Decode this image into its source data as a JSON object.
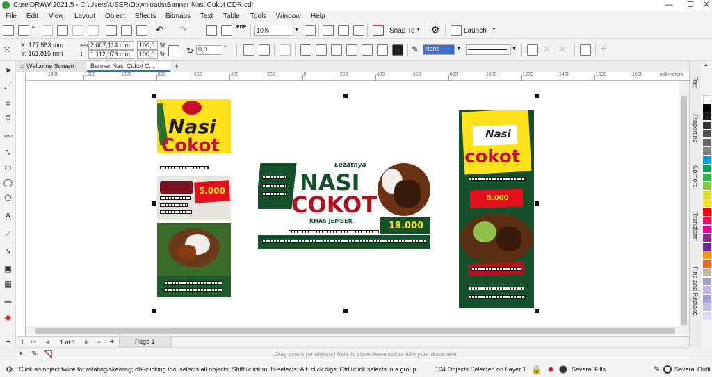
{
  "window": {
    "title": "CorelDRAW 2021.5 - C:\\Users\\USER\\Downloads\\Banner Nasi Cokot CDR.cdr",
    "minimize": "—",
    "maximize": "☐",
    "close": "✕"
  },
  "menu": [
    "File",
    "Edit",
    "View",
    "Layout",
    "Object",
    "Effects",
    "Bitmaps",
    "Text",
    "Table",
    "Tools",
    "Window",
    "Help"
  ],
  "standard_toolbar": {
    "zoom": "10%",
    "snap_to": "Snap To",
    "launch": "Launch"
  },
  "property_bar": {
    "x": "X: 177,553 mm",
    "y": "Y: 161,816 mm",
    "width": "2.007,114 mm",
    "height": "1.112,073 mm",
    "scale_w": "100,0",
    "scale_h": "100,0",
    "percent": "%",
    "angle": "0,0",
    "angle_unit": "°",
    "outline_fill": "None"
  },
  "tabs": [
    "Welcome Screen",
    "Banner Nasi Cokot C..."
  ],
  "ruler": {
    "labels": [
      "1400",
      "1200",
      "1000",
      "800",
      "600",
      "400",
      "200",
      "0",
      "200",
      "400",
      "600",
      "800",
      "1000",
      "1200",
      "1400",
      "1600",
      "1800"
    ],
    "unit": "millimeters"
  },
  "dockers": [
    "Text",
    "Properties",
    "Corners",
    "Transform",
    "Find and Replace"
  ],
  "page_nav": {
    "count": "1 of 1",
    "page_tab": "Page 1"
  },
  "color_tray_hint": "Drag colors (or objects) here to store these colors with your document",
  "status": {
    "hint": "Click an object twice for rotating/skewing; dbl-clicking tool selects all objects; Shift+click multi-selects; Alt+click digs; Ctrl+click selects in a group",
    "selection": "104 Objects Selected on Layer 1",
    "fill": "Several Fills",
    "outline": "Several Outli"
  },
  "palette_colors": [
    "#ffffff",
    "#000000",
    "#1a1a1a",
    "#333333",
    "#4d4d4d",
    "#666666",
    "#808080",
    "#00a0e9",
    "#00a651",
    "#39b54a",
    "#8dc63f",
    "#d7df23",
    "#ffde17",
    "#ff0000",
    "#ed145b",
    "#ec008c",
    "#92278f",
    "#662d91",
    "#f7941d",
    "#f26522",
    "#c2b59b",
    "#a3a3c2",
    "#c7b2de",
    "#9e9ee0",
    "#bfbfe0",
    "#d9d9f0"
  ],
  "artwork": {
    "banner_left": {
      "line1": "Nasi",
      "line2": "Cokot",
      "price": "5.000"
    },
    "banner_center": {
      "script": "Lezatnya",
      "line1": "NASI",
      "line2": "COKOT",
      "sub": "KHAS JEMBER",
      "price": "18.000"
    },
    "banner_right": {
      "line1": "Nasi",
      "line2": "cokot",
      "price": "5.000"
    }
  }
}
